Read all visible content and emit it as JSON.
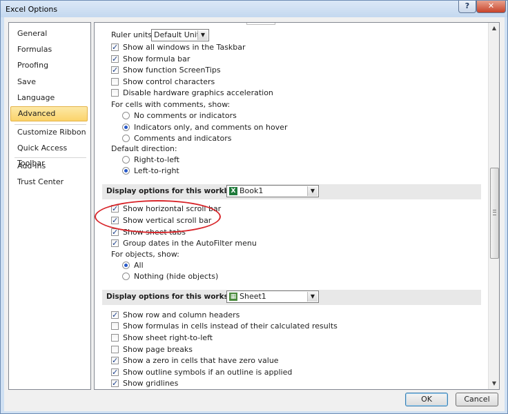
{
  "window": {
    "title": "Excel Options",
    "help_label": "?",
    "close_label": "✕"
  },
  "nav": {
    "items": [
      {
        "label": "General"
      },
      {
        "label": "Formulas"
      },
      {
        "label": "Proofing"
      },
      {
        "label": "Save"
      },
      {
        "label": "Language"
      },
      {
        "label": "Advanced"
      },
      {
        "label": "Customize Ribbon"
      },
      {
        "label": "Quick Access Toolbar"
      },
      {
        "label": "Add-Ins"
      },
      {
        "label": "Trust Center"
      }
    ],
    "selected": "Advanced"
  },
  "display": {
    "ruler_units_label": "Ruler units",
    "ruler_units_value": "Default Units",
    "options": [
      {
        "label": "Show all windows in the Taskbar",
        "checked": true
      },
      {
        "label": "Show formula bar",
        "checked": true
      },
      {
        "label": "Show function ScreenTips",
        "checked": true
      },
      {
        "label": "Show control characters",
        "checked": false
      },
      {
        "label": "Disable hardware graphics acceleration",
        "checked": false
      }
    ],
    "comments_label": "For cells with comments, show:",
    "comments_options": [
      {
        "label": "No comments or indicators",
        "selected": false
      },
      {
        "label": "Indicators only, and comments on hover",
        "selected": true
      },
      {
        "label": "Comments and indicators",
        "selected": false
      }
    ],
    "direction_label": "Default direction:",
    "direction_options": [
      {
        "label": "Right-to-left",
        "selected": false
      },
      {
        "label": "Left-to-right",
        "selected": true
      }
    ]
  },
  "workbook": {
    "header": "Display options for this workbook:",
    "combo_value": "Book1",
    "options": [
      {
        "label": "Show horizontal scroll bar",
        "checked": true
      },
      {
        "label": "Show vertical scroll bar",
        "checked": true
      },
      {
        "label": "Show sheet tabs",
        "checked": true
      },
      {
        "label": "Group dates in the AutoFilter menu",
        "checked": true
      }
    ],
    "objects_label": "For objects, show:",
    "objects_options": [
      {
        "label": "All",
        "selected": true
      },
      {
        "label": "Nothing (hide objects)",
        "selected": false
      }
    ]
  },
  "worksheet": {
    "header": "Display options for this worksheet:",
    "combo_value": "Sheet1",
    "options": [
      {
        "label": "Show row and column headers",
        "checked": true
      },
      {
        "label": "Show formulas in cells instead of their calculated results",
        "checked": false
      },
      {
        "label": "Show sheet right-to-left",
        "checked": false
      },
      {
        "label": "Show page breaks",
        "checked": false
      },
      {
        "label": "Show a zero in cells that have zero value",
        "checked": true
      },
      {
        "label": "Show outline symbols if an outline is applied",
        "checked": true
      },
      {
        "label": "Show gridlines",
        "checked": true
      }
    ]
  },
  "buttons": {
    "ok": "OK",
    "cancel": "Cancel"
  }
}
